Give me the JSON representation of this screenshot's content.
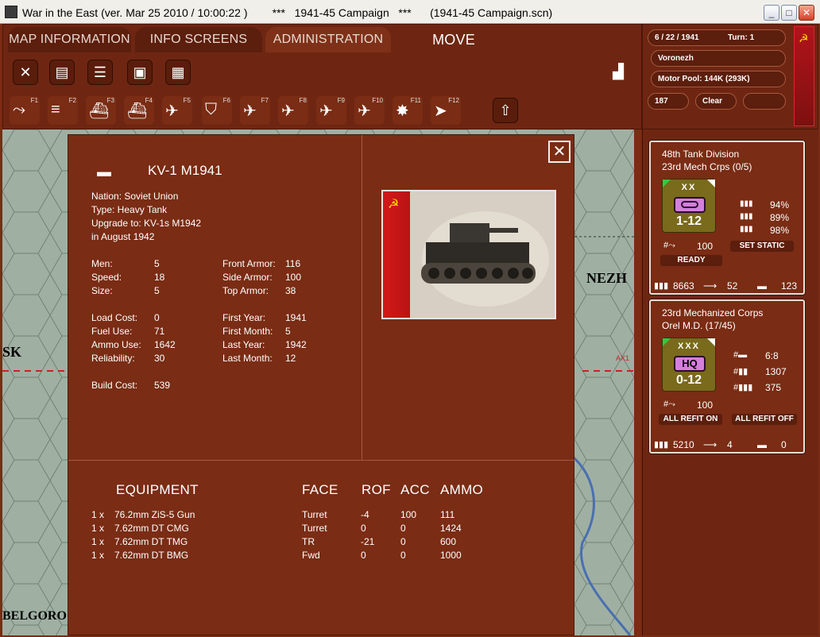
{
  "window": {
    "title": "War in the East (ver. Mar 25 2010 / 10:00:22 )        ***   1941-45 Campaign   ***      (1941-45 Campaign.scn)",
    "min": "_",
    "max": "□",
    "close": "✕"
  },
  "tabs": [
    "MAP INFORMATION",
    "INFO SCREENS",
    "ADMINISTRATION",
    "MOVE"
  ],
  "status": {
    "date": "6 / 22 / 1941",
    "turn": "Turn: 1",
    "location": "Voronezh",
    "motor_pool": "Motor Pool:  144K  (293K)",
    "value": "187",
    "weather": "Clear",
    "blank": ""
  },
  "fkeys": [
    "F1",
    "F2",
    "F3",
    "F4",
    "F5",
    "F6",
    "F7",
    "F8",
    "F9",
    "F10",
    "F11",
    "F12"
  ],
  "map": {
    "labels": [
      "SK",
      "BELGORO",
      "NEZH",
      "AX1"
    ]
  },
  "panel": {
    "close": "✕",
    "unit_name": "KV-1 M1941",
    "nation": "Nation: Soviet Union",
    "type": "Type: Heavy Tank",
    "upgrade": "Upgrade to: KV-1s M1942",
    "upgrade_date": "in August 1942",
    "stats_left": [
      {
        "label": "Men:",
        "value": "5"
      },
      {
        "label": "Speed:",
        "value": "18"
      },
      {
        "label": "Size:",
        "value": "5"
      }
    ],
    "stats_right": [
      {
        "label": "Front Armor:",
        "value": "116"
      },
      {
        "label": "Side Armor:",
        "value": "100"
      },
      {
        "label": "Top Armor:",
        "value": "38"
      }
    ],
    "stats_left2": [
      {
        "label": "Load Cost:",
        "value": "0"
      },
      {
        "label": "Fuel Use:",
        "value": "71"
      },
      {
        "label": "Ammo Use:",
        "value": "1642"
      },
      {
        "label": "Reliability:",
        "value": "30"
      }
    ],
    "stats_right2": [
      {
        "label": "First Year:",
        "value": "1941"
      },
      {
        "label": "First Month:",
        "value": "5"
      },
      {
        "label": "Last Year:",
        "value": "1942"
      },
      {
        "label": "Last Month:",
        "value": "12"
      }
    ],
    "build_cost": {
      "label": "Build Cost:",
      "value": "539"
    },
    "equip_headers": {
      "equipment": "EQUIPMENT",
      "face": "FACE",
      "rof": "ROF",
      "acc": "ACC",
      "ammo": "AMMO"
    },
    "equipment": [
      {
        "qty": "1  x",
        "name": "76.2mm ZiS-5 Gun",
        "face": "Turret",
        "rof": "-4",
        "acc": "100",
        "ammo": "111"
      },
      {
        "qty": "1  x",
        "name": "7.62mm DT CMG",
        "face": "Turret",
        "rof": "0",
        "acc": "0",
        "ammo": "1424"
      },
      {
        "qty": "1  x",
        "name": "7.62mm DT TMG",
        "face": "TR",
        "rof": "-21",
        "acc": "0",
        "ammo": "600"
      },
      {
        "qty": "1  x",
        "name": "7.62mm DT BMG",
        "face": "Fwd",
        "rof": "0",
        "acc": "0",
        "ammo": "1000"
      }
    ]
  },
  "unit1": {
    "name": "48th Tank Division",
    "sub": "23rd Mech Crps (0/5)",
    "echelon": "XX",
    "factor": "1-12",
    "p1": "94%",
    "p2": "89%",
    "p3": "98%",
    "mp": "100",
    "btn_static": "SET STATIC",
    "btn_ready": "READY",
    "men": "8663",
    "guns": "52",
    "afv": "123"
  },
  "unit2": {
    "name": "23rd Mechanized Corps",
    "sub": "Orel M.D. (17/45)",
    "echelon": "XXX",
    "hq": "HQ",
    "factor": "0-12",
    "r1": "6:8",
    "r2": "1307",
    "r3": "375",
    "mp": "100",
    "btn_on": "ALL REFIT ON",
    "btn_off": "ALL REFIT OFF",
    "men": "5210",
    "guns": "4",
    "afv": "0"
  },
  "colors": {
    "bg": "#7a2c14",
    "panel": "#6e2612",
    "accent": "#d57fdc",
    "counter": "#7a6a1c"
  }
}
